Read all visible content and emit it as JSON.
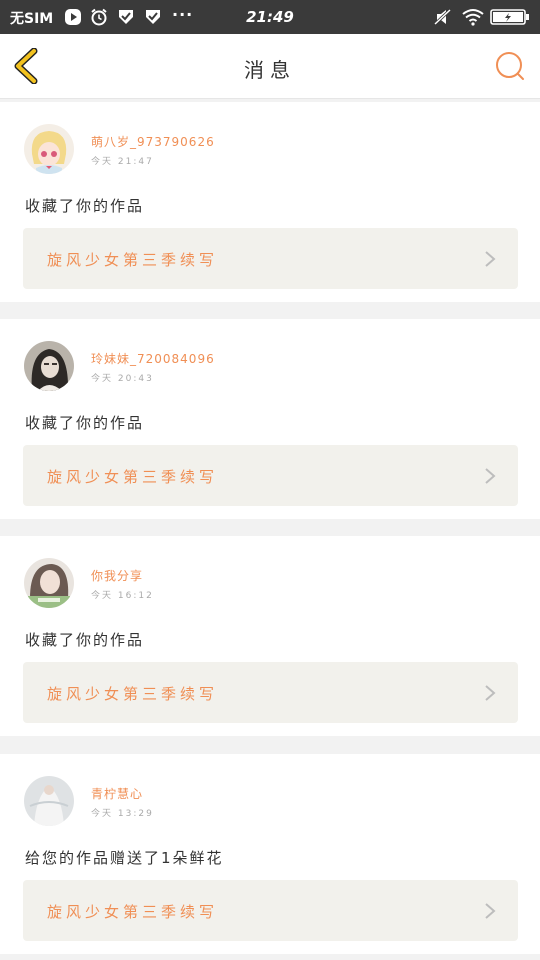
{
  "status_bar": {
    "carrier": "无SIM",
    "time": "21:49",
    "more": "···"
  },
  "header": {
    "title": "消息"
  },
  "messages": [
    {
      "username": "萌八岁_973790626",
      "time": "今天 21:47",
      "action": "收藏了你的作品",
      "work_title": "旋风少女第三季续写"
    },
    {
      "username": "玲妹妹_720084096",
      "time": "今天 20:43",
      "action": "收藏了你的作品",
      "work_title": "旋风少女第三季续写"
    },
    {
      "username": "你我分享",
      "time": "今天 16:12",
      "action": "收藏了你的作品",
      "work_title": "旋风少女第三季续写"
    },
    {
      "username": "青柠慧心",
      "time": "今天 13:29",
      "action": "给您的作品赠送了1朵鲜花",
      "work_title": "旋风少女第三季续写"
    }
  ],
  "colors": {
    "accent": "#f08f55",
    "back_arrow": "#f2c21f",
    "status_bar": "#3a3a3a"
  }
}
